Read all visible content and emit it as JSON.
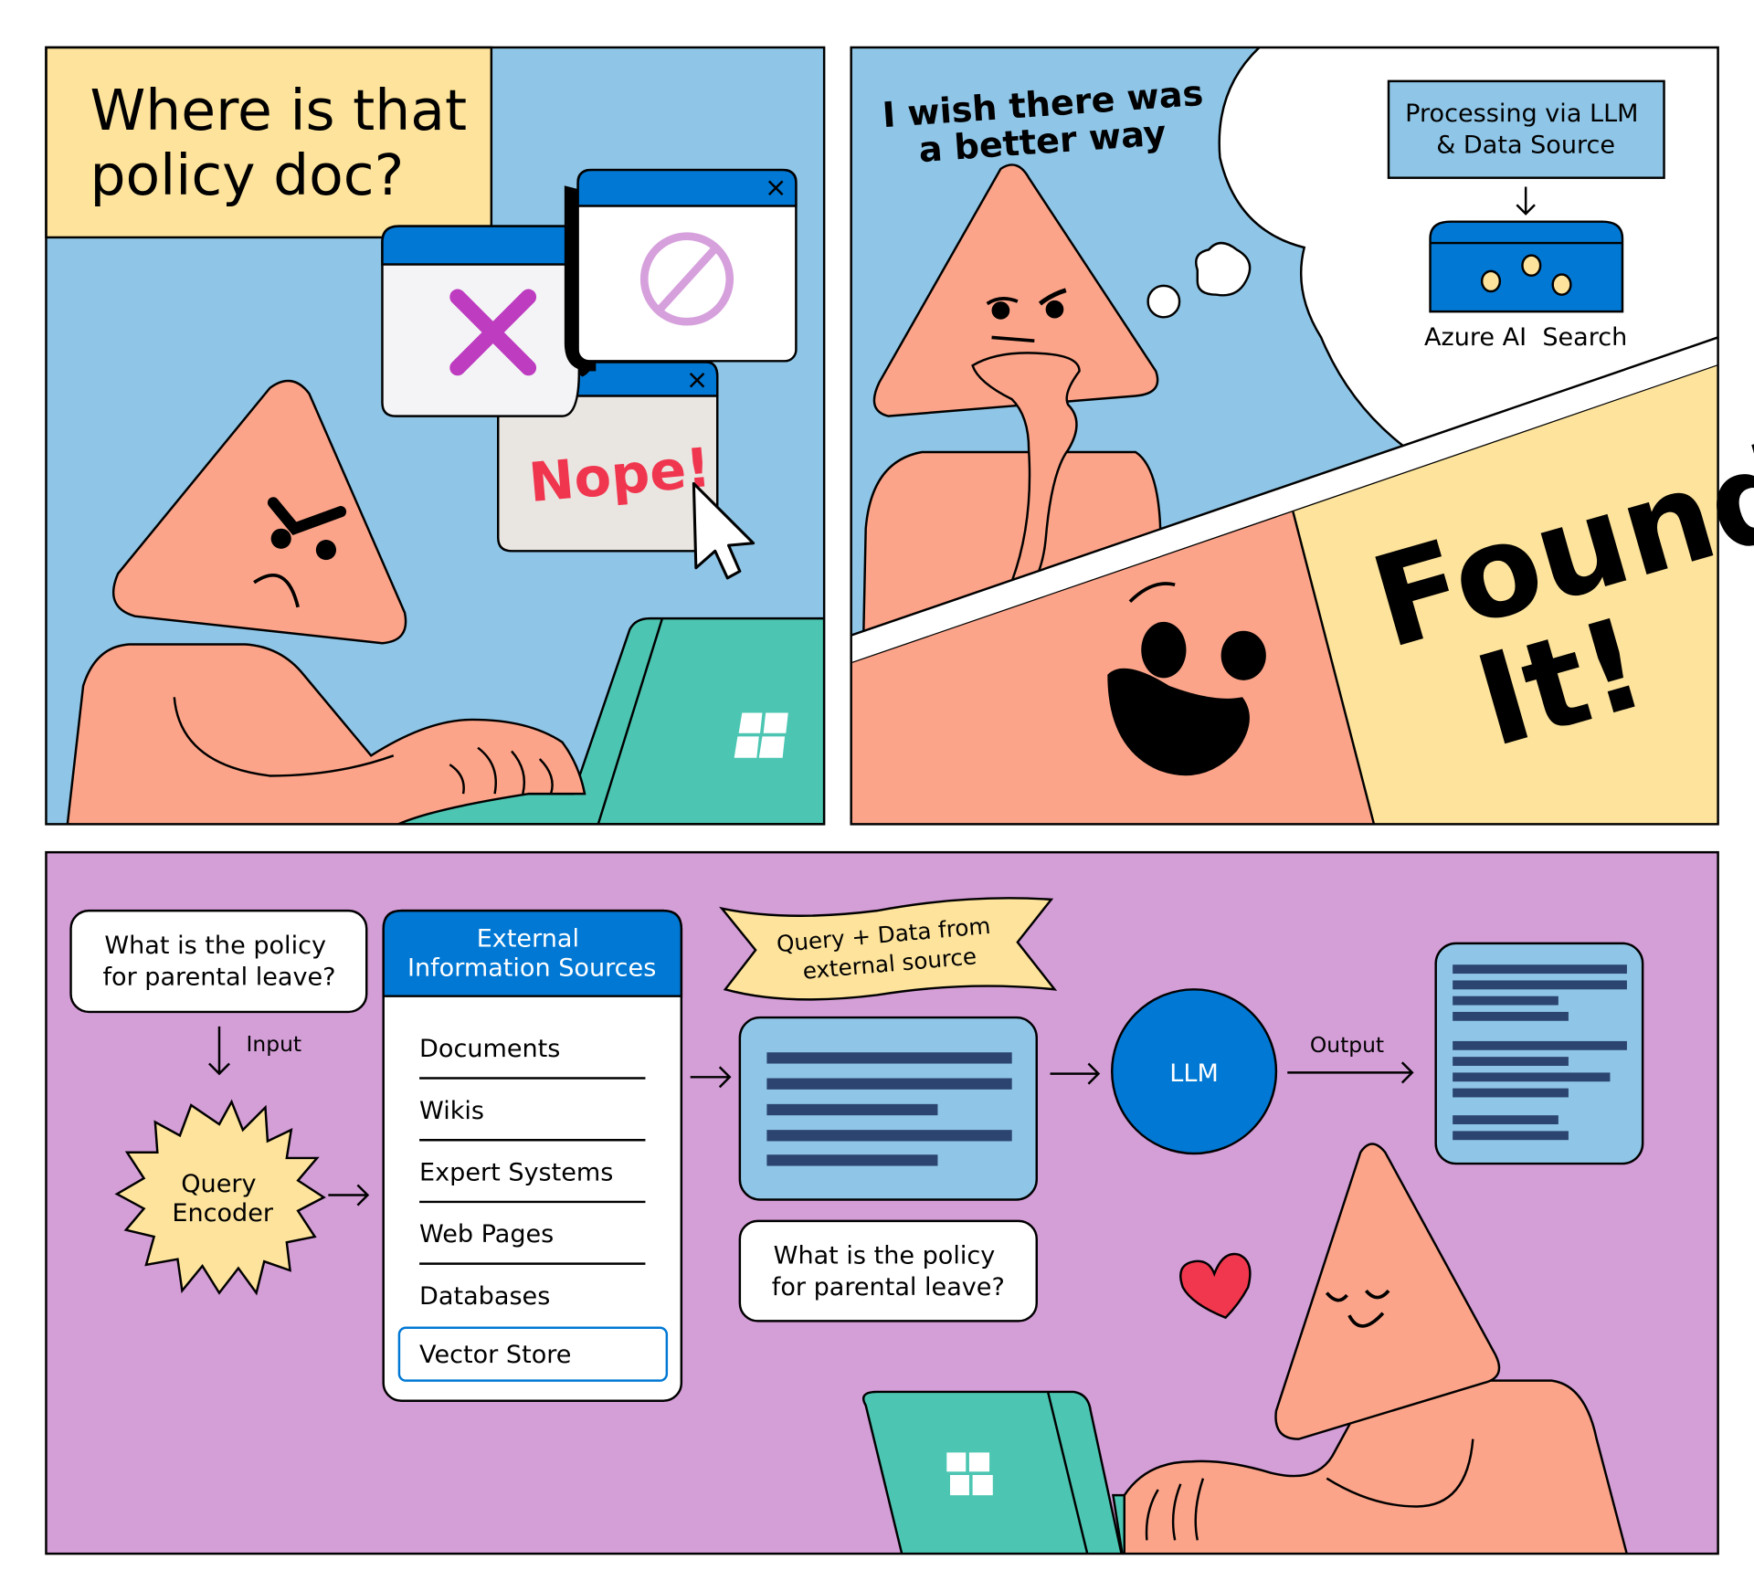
{
  "colors": {
    "sky_blue": "#8fc6e7",
    "cream_yellow": "#fde39b",
    "skin": "#fca489",
    "teal_laptop": "#4cc6b2",
    "azure_blue": "#0078d4",
    "lavender": "#d49ed7",
    "navy_lines": "#2b4470",
    "nope_red": "#f0364f",
    "x_magenta": "#bd3cc0",
    "ban_pink": "#d6a0dc",
    "heart_red": "#f0374d",
    "dot_yellow": "#fde39b"
  },
  "panel1": {
    "caption": [
      "Where is that",
      "policy doc?"
    ],
    "popup_nope_text": "Nope!",
    "icons": [
      "close-x-icon",
      "no-entry-icon",
      "window-close-icon",
      "mouse-pointer-icon",
      "windows-logo-icon"
    ]
  },
  "panel2": {
    "speech": [
      "I wish there was",
      "a better way"
    ],
    "thought_box": [
      "Processing via LLM",
      "& Data Source"
    ],
    "search_label": "Azure AI  Search"
  },
  "panel3": {
    "exclaim": [
      "Found",
      "It!"
    ]
  },
  "bottom": {
    "question": [
      "What is the policy",
      "for parental leave?"
    ],
    "input_label": "Input",
    "encoder": [
      "Query",
      "Encoder"
    ],
    "sources_header": [
      "External",
      "Information Sources"
    ],
    "sources": [
      "Documents",
      "Wikis",
      "Expert Systems",
      "Web Pages",
      "Databases",
      "Vector Store"
    ],
    "selected_source": "Vector Store",
    "banner": [
      "Query + Data from",
      "external source"
    ],
    "question_copy": [
      "What is the policy",
      "for parental leave?"
    ],
    "llm_label": "LLM",
    "output_label": "Output"
  }
}
